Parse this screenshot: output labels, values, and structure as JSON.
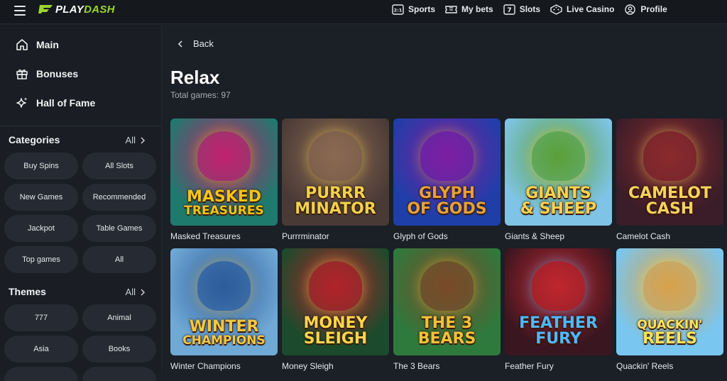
{
  "brand": {
    "name_part1": "PLAY",
    "name_part2": "DASH",
    "accent": "#9ad32f"
  },
  "topnav": [
    {
      "label": "Sports",
      "icon": "sports-icon"
    },
    {
      "label": "My bets",
      "icon": "ticket-icon"
    },
    {
      "label": "Slots",
      "icon": "slots-icon"
    },
    {
      "label": "Live Casino",
      "icon": "dice-icon"
    },
    {
      "label": "Profile",
      "icon": "profile-icon"
    }
  ],
  "sidebar": {
    "menu": [
      {
        "label": "Main",
        "icon": "home-icon"
      },
      {
        "label": "Bonuses",
        "icon": "gift-icon"
      },
      {
        "label": "Hall of Fame",
        "icon": "sparkle-icon"
      }
    ],
    "categories": {
      "title": "Categories",
      "all_label": "All",
      "items": [
        "Buy Spins",
        "All Slots",
        "New Games",
        "Recommended",
        "Jackpot",
        "Table Games",
        "Top games",
        "All"
      ]
    },
    "themes": {
      "title": "Themes",
      "all_label": "All",
      "items": [
        "777",
        "Animal",
        "Asia",
        "Books"
      ]
    }
  },
  "main": {
    "back_label": "Back",
    "title": "Relax",
    "total_games": "Total games: 97",
    "games": [
      {
        "name": "Masked Treasures",
        "logo_lines": [
          "MASKED",
          "TREASURES"
        ],
        "colors": [
          "#1f7a6e",
          "#c0226f",
          "#f4c514"
        ]
      },
      {
        "name": "Purrrminator",
        "logo_lines": [
          "PURRR",
          "MINATOR"
        ],
        "colors": [
          "#4a3a36",
          "#8b6a52",
          "#f2d14b"
        ]
      },
      {
        "name": "Glyph of Gods",
        "logo_lines": [
          "GLYPH",
          "OF GODS"
        ],
        "colors": [
          "#1e3fa8",
          "#7d1fa3",
          "#e5a03a"
        ]
      },
      {
        "name": "Giants & Sheep",
        "logo_lines": [
          "GIANTS",
          "& SHEEP"
        ],
        "colors": [
          "#7fc4e6",
          "#5aa03a",
          "#ffd24d"
        ]
      },
      {
        "name": "Camelot Cash",
        "logo_lines": [
          "CAMELOT",
          "CASH"
        ],
        "colors": [
          "#3a1d28",
          "#8b2a2f",
          "#f6d25c"
        ]
      },
      {
        "name": "Winter Champions",
        "logo_lines": [
          "WINTER",
          "CHAMPIONS"
        ],
        "colors": [
          "#6fa9d6",
          "#2d5c9a",
          "#f5c842"
        ]
      },
      {
        "name": "Money Sleigh",
        "logo_lines": [
          "MONEY",
          "SLEIGH"
        ],
        "colors": [
          "#1b4b2c",
          "#b3232a",
          "#ffd64a"
        ]
      },
      {
        "name": "The 3 Bears",
        "logo_lines": [
          "THE 3",
          "BEARS"
        ],
        "colors": [
          "#2e7a3c",
          "#7a4a2a",
          "#f6c03a"
        ]
      },
      {
        "name": "Feather Fury",
        "logo_lines": [
          "FEATHER",
          "FURY"
        ],
        "colors": [
          "#3a1620",
          "#c0262e",
          "#4fb8ff"
        ]
      },
      {
        "name": "Quackin' Reels",
        "logo_lines": [
          "QUACKIN'",
          "REELS"
        ],
        "colors": [
          "#79c6f0",
          "#d9a24a",
          "#ffe35a"
        ]
      }
    ]
  }
}
